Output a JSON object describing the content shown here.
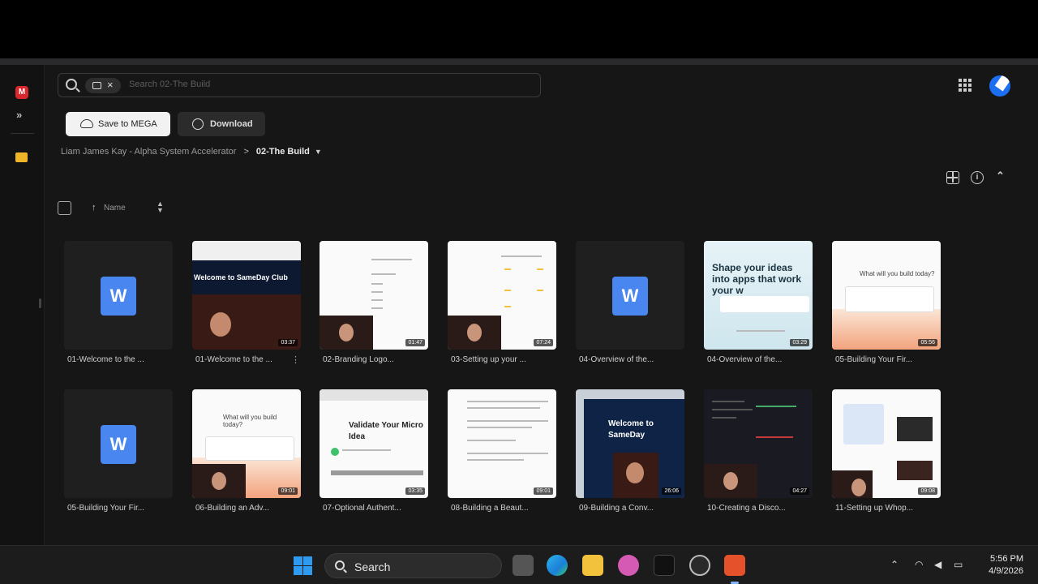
{
  "search": {
    "placeholder": "Search 02-The Build"
  },
  "actions": {
    "save_label": "Save to MEGA",
    "download_label": "Download"
  },
  "breadcrumb": {
    "parent": "Liam James Kay - Alpha System Accelerator",
    "separator": ">",
    "current": "02-The Build"
  },
  "sort": {
    "label": "Name"
  },
  "files": [
    {
      "name": "01-Welcome to the ...",
      "type": "word"
    },
    {
      "name": "01-Welcome to the ...",
      "type": "video",
      "duration": "03:37"
    },
    {
      "name": "02-Branding Logo...",
      "type": "video",
      "duration": "01:47"
    },
    {
      "name": "03-Setting up your ...",
      "type": "video",
      "duration": "07:24"
    },
    {
      "name": "04-Overview of the...",
      "type": "word"
    },
    {
      "name": "04-Overview of the...",
      "type": "video",
      "duration": "03:29",
      "headline": "Shape your ideas into apps that work your w"
    },
    {
      "name": "05-Building Your Fir...",
      "type": "video",
      "duration": "05:56",
      "headline": "What will you build today?"
    },
    {
      "name": "05-Building Your Fir...",
      "type": "word"
    },
    {
      "name": "06-Building an Adv...",
      "type": "video",
      "duration": "09:01",
      "headline": "What will you build today?"
    },
    {
      "name": "07-Optional Authent...",
      "type": "video",
      "duration": "03:35",
      "headline": "Validate Your Micro Idea"
    },
    {
      "name": "08-Building a Beaut...",
      "type": "video",
      "duration": "09:01"
    },
    {
      "name": "09-Building a Conv...",
      "type": "video",
      "duration": "26:06",
      "headline": "Welcome to SameDay"
    },
    {
      "name": "10-Creating a Disco...",
      "type": "video",
      "duration": "04:27"
    },
    {
      "name": "11-Setting up Whop...",
      "type": "video",
      "duration": "09:08"
    }
  ],
  "taskbar": {
    "search_label": "Search",
    "time": "5:56 PM",
    "date": "4/9/2026"
  },
  "colors": {
    "background": "#161616",
    "accent_blue": "#4a86f0",
    "mega_red": "#d9272e",
    "folder": "#f0b429"
  }
}
